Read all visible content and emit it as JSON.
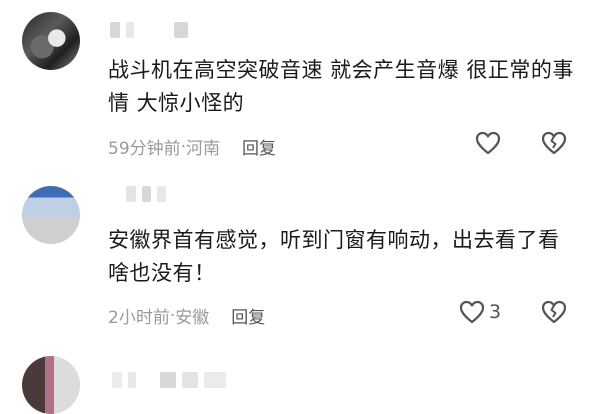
{
  "comments": [
    {
      "text": "战斗机在高空突破音速 就会产生音爆 很正常的事情 大惊小怪的",
      "time": "59分钟前",
      "location": "河南",
      "reply": "回复",
      "likes": ""
    },
    {
      "text": "安徽界首有感觉，听到门窗有响动，出去看了看啥也没有！",
      "time": "2小时前",
      "location": "安徽",
      "reply": "回复",
      "likes": "3"
    }
  ],
  "separator": " · ",
  "icons": {
    "like": "heart-outline-icon",
    "dislike": "broken-heart-icon"
  },
  "colors": {
    "meta": "#9a9a9a",
    "icon": "#555555"
  }
}
